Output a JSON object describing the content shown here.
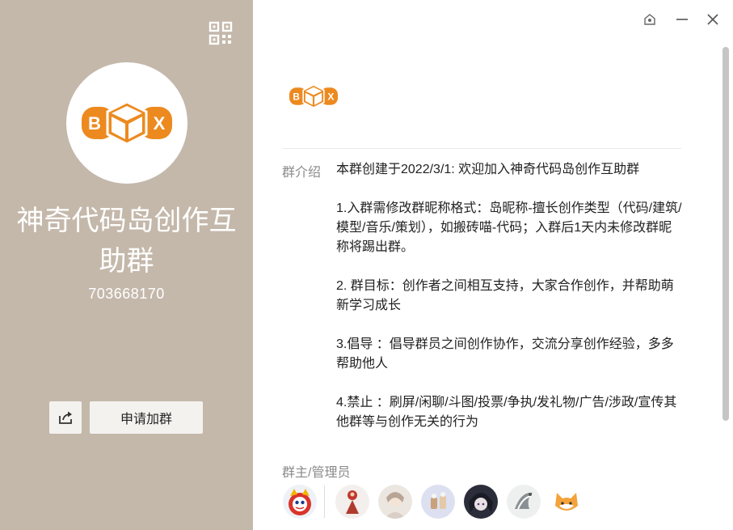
{
  "colors": {
    "left_bg": "#c4b8ab",
    "brand_orange": "#ec8a1f",
    "button_bg": "#f4f2ef"
  },
  "group": {
    "name": "神奇代码岛创作互助群",
    "id": "703668170",
    "logo_letters": [
      "B",
      "X"
    ]
  },
  "actions": {
    "join_label": "申请加群",
    "share_icon": "share-icon",
    "qr_icon": "qr-code-icon"
  },
  "titlebar": {
    "icons": [
      "pin-icon",
      "minimize-icon",
      "close-icon"
    ]
  },
  "intro": {
    "label": "群介绍",
    "text": "本群创建于2022/3/1: 欢迎加入神奇代码岛创作互助群\n\n1.入群需修改群昵称格式：岛昵称-擅长创作类型（代码/建筑/模型/音乐/策划），如搬砖喵-代码；入群后1天内未修改群昵称将踢出群。\n\n2. 群目标：创作者之间相互支持，大家合作创作，并帮助萌新学习成长\n\n3.倡导 ：倡导群员之间创作协作，交流分享创作经验，多多帮助他人\n\n4.禁止 ：刷屏/闲聊/斗图/投票/争执/发礼物/广告/涉政/宣传其他群等与创作无关的行为"
  },
  "admins": {
    "label": "群主/管理员",
    "avatars": [
      "owner-avatar",
      "admin-avatar-1",
      "admin-avatar-2",
      "admin-avatar-3",
      "admin-avatar-4",
      "admin-avatar-5",
      "admin-avatar-6"
    ]
  }
}
